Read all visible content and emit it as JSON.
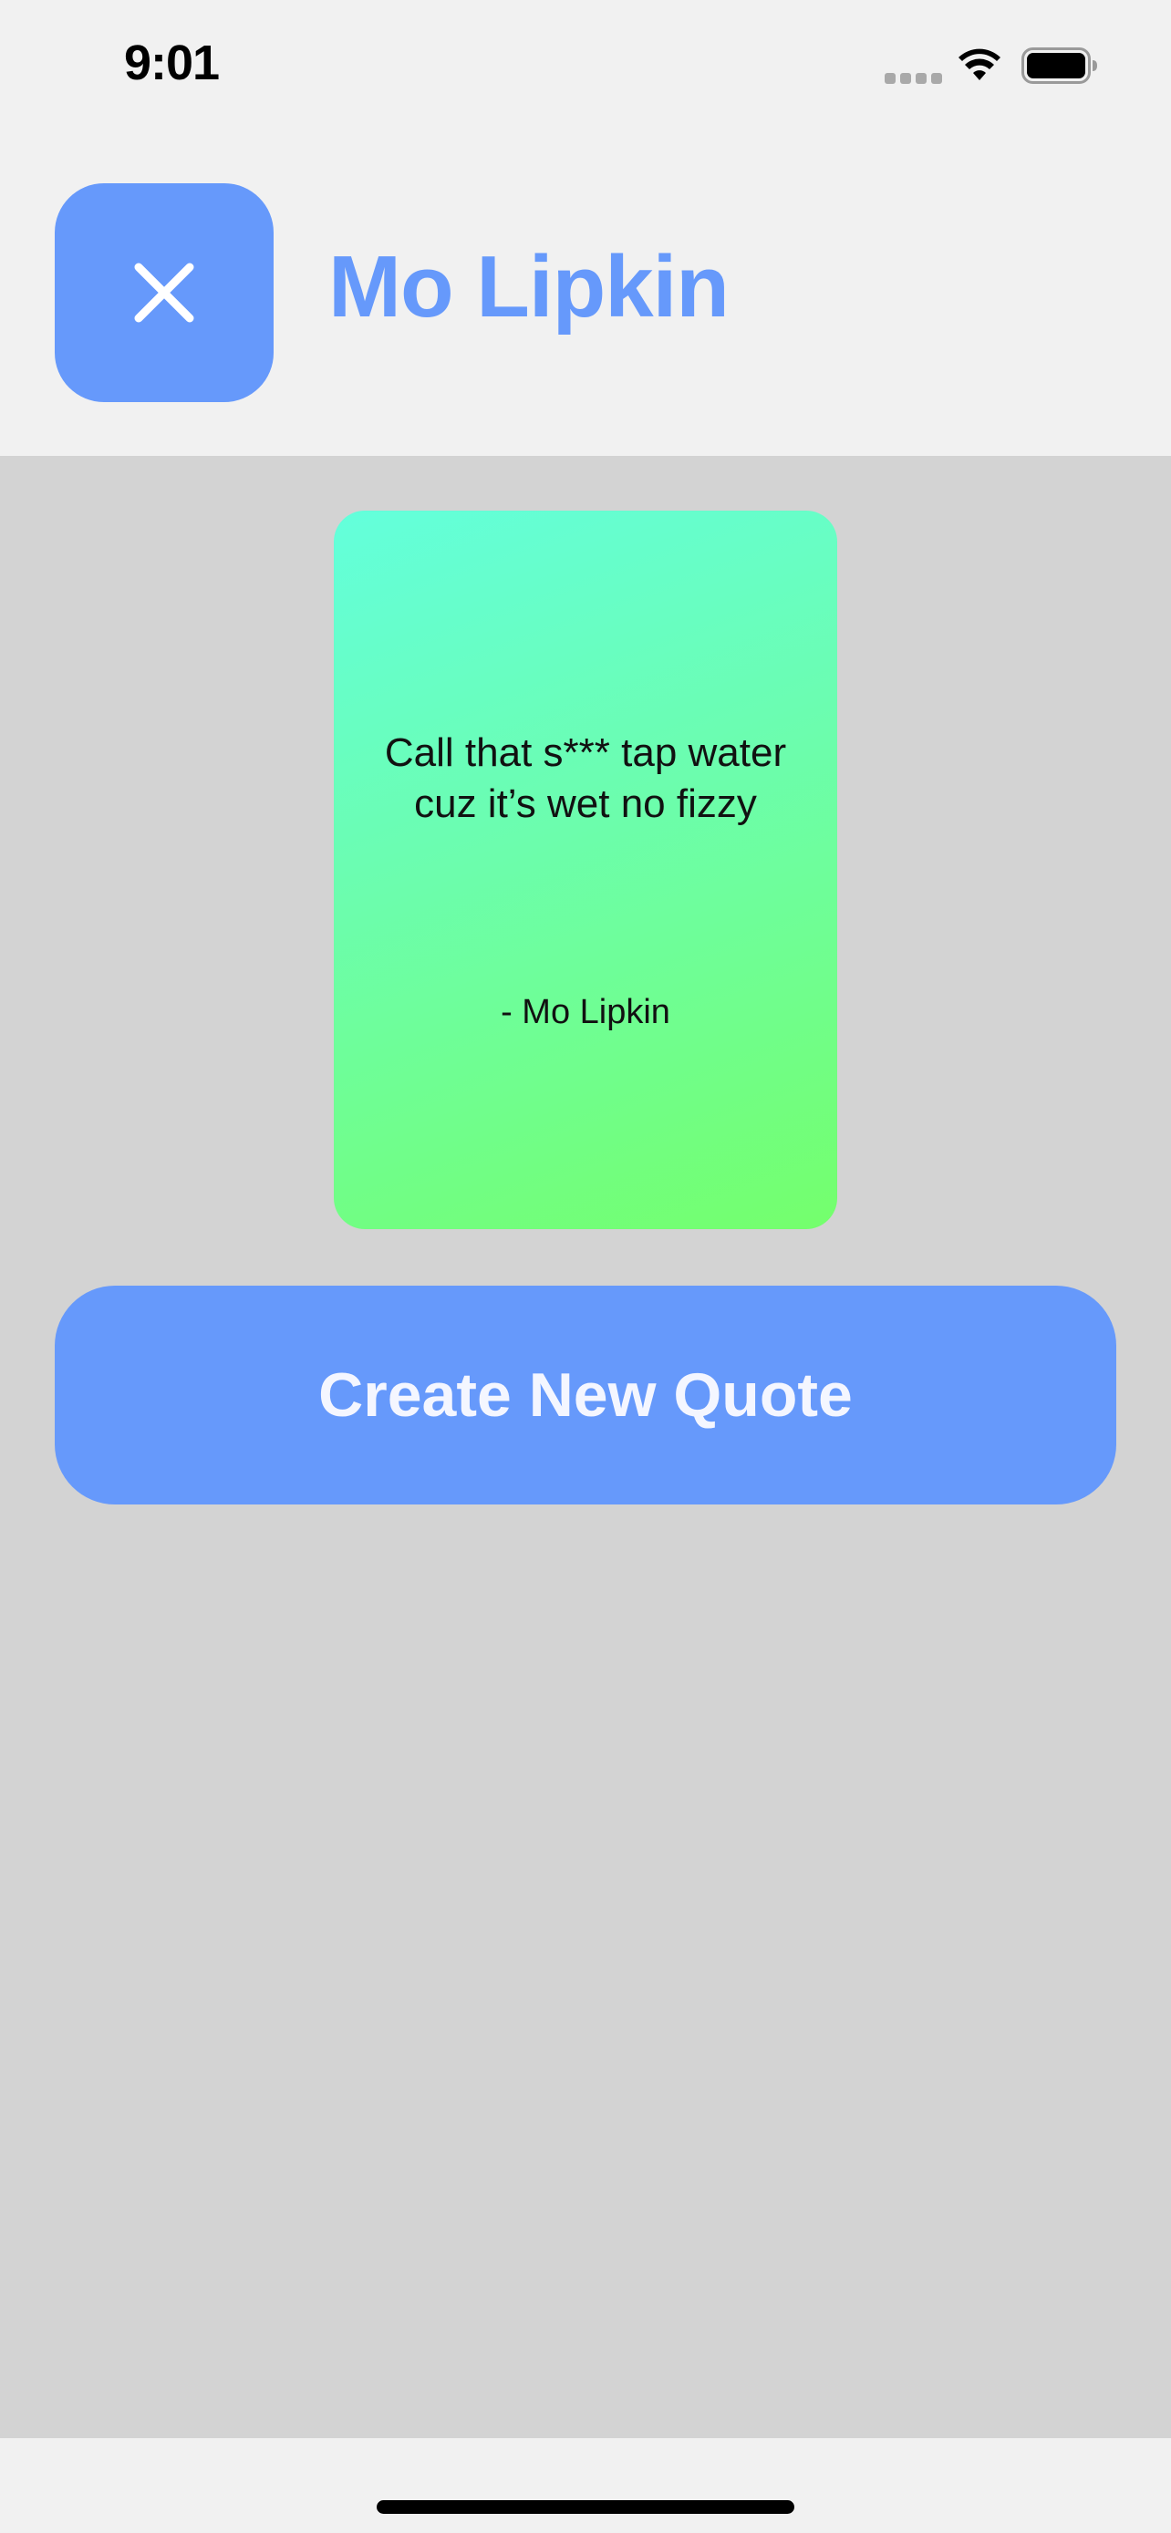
{
  "status_bar": {
    "time": "9:01",
    "icons": [
      "signal-icon",
      "wifi-icon",
      "battery-icon"
    ]
  },
  "header": {
    "close_icon": "close-icon",
    "title": "Mo Lipkin"
  },
  "quote_card": {
    "text": "Call that s*** tap water cuz it’s wet no fizzy",
    "author": "- Mo Lipkin"
  },
  "actions": {
    "create_label": "Create New Quote"
  },
  "colors": {
    "accent": "#6699fb",
    "content_background": "#d3d3d3",
    "chrome_background": "#f1f1f1",
    "card_gradient_start": "#63ffdc",
    "card_gradient_end": "#74ff6c"
  }
}
